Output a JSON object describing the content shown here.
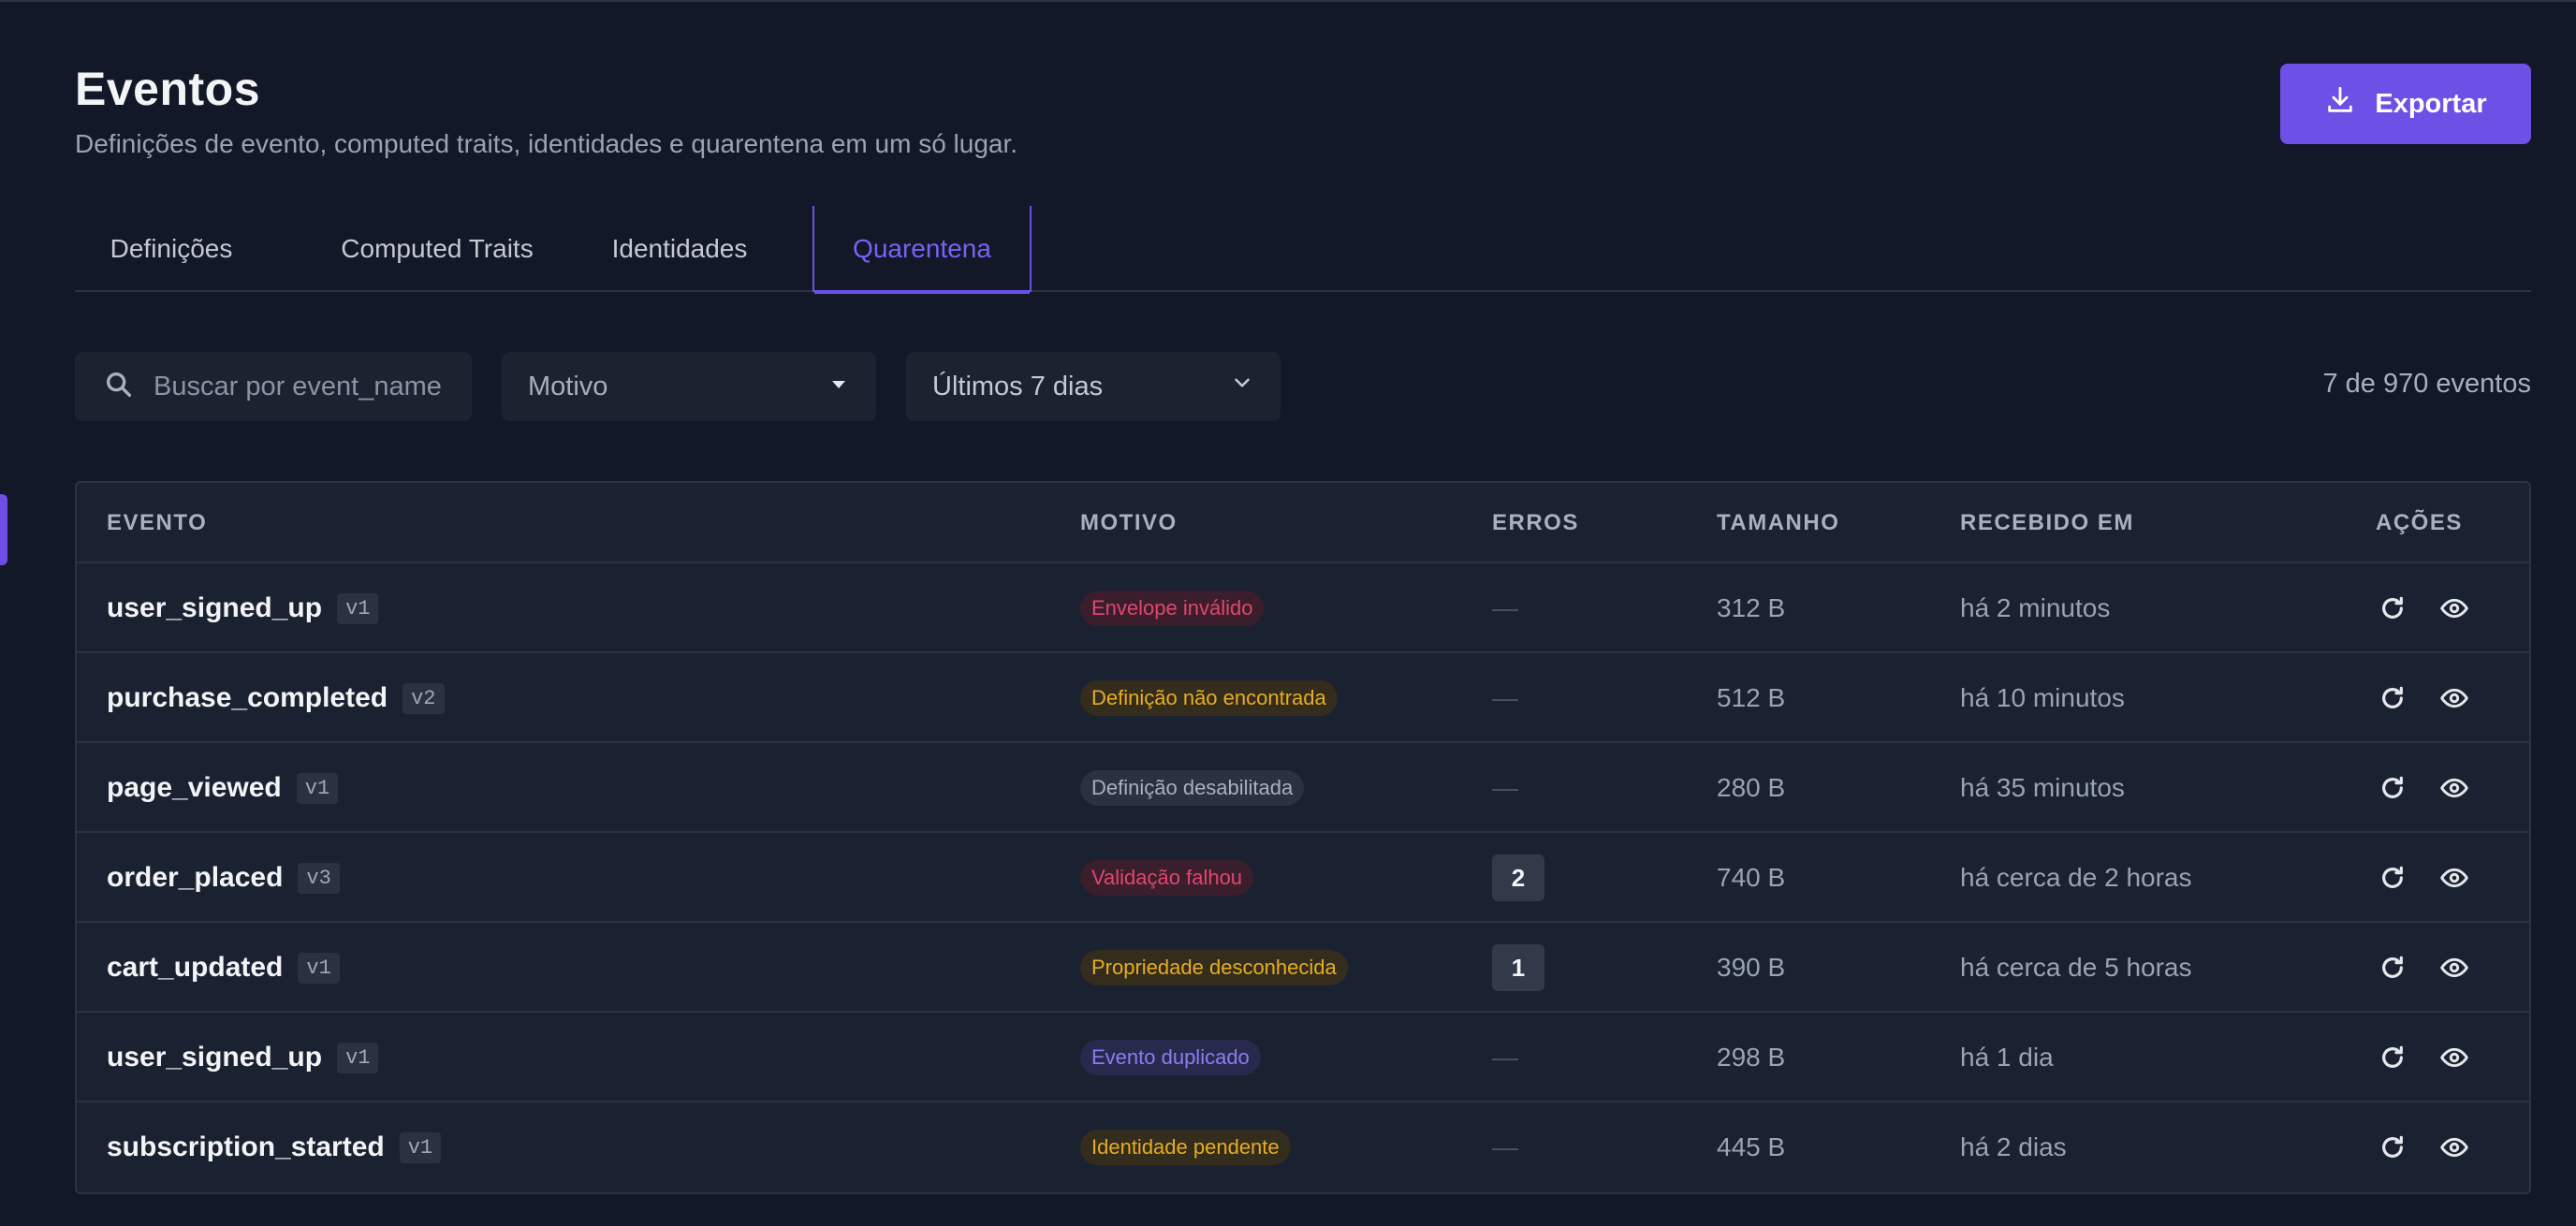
{
  "header": {
    "title": "Eventos",
    "subtitle": "Definições de evento, computed traits, identidades e quarentena em um só lugar.",
    "export_label": "Exportar"
  },
  "tabs": [
    {
      "label": "Definições",
      "active": false
    },
    {
      "label": "Computed Traits",
      "active": false
    },
    {
      "label": "Identidades",
      "active": false
    },
    {
      "label": "Quarentena",
      "active": true
    }
  ],
  "filters": {
    "search_placeholder": "Buscar por event_name",
    "reason_label": "Motivo",
    "period_label": "Últimos 7 dias",
    "count_text": "7 de 970 eventos"
  },
  "table": {
    "columns": [
      "EVENTO",
      "MOTIVO",
      "ERROS",
      "TAMANHO",
      "RECEBIDO EM",
      "AÇÕES"
    ],
    "rows": [
      {
        "event": "user_signed_up",
        "version": "v1",
        "reason": "Envelope inválido",
        "reason_color": "red",
        "errors": "—",
        "size": "312 B",
        "received": "há 2 minutos"
      },
      {
        "event": "purchase_completed",
        "version": "v2",
        "reason": "Definição não encontrada",
        "reason_color": "yellow",
        "errors": "—",
        "size": "512 B",
        "received": "há 10 minutos"
      },
      {
        "event": "page_viewed",
        "version": "v1",
        "reason": "Definição desabilitada",
        "reason_color": "gray",
        "errors": "—",
        "size": "280 B",
        "received": "há 35 minutos"
      },
      {
        "event": "order_placed",
        "version": "v3",
        "reason": "Validação falhou",
        "reason_color": "red",
        "errors": "2",
        "size": "740 B",
        "received": "há cerca de 2 horas"
      },
      {
        "event": "cart_updated",
        "version": "v1",
        "reason": "Propriedade desconhecida",
        "reason_color": "yellow",
        "errors": "1",
        "size": "390 B",
        "received": "há cerca de 5 horas"
      },
      {
        "event": "user_signed_up",
        "version": "v1",
        "reason": "Evento duplicado",
        "reason_color": "purple",
        "errors": "—",
        "size": "298 B",
        "received": "há 1 dia"
      },
      {
        "event": "subscription_started",
        "version": "v1",
        "reason": "Identidade pendente",
        "reason_color": "yellow",
        "errors": "—",
        "size": "445 B",
        "received": "há 2 dias"
      }
    ]
  },
  "icons": {
    "export": "download-icon",
    "search": "search-icon",
    "reason_select": "caret-down-icon",
    "period_select": "chevron-down-icon",
    "retry": "refresh-icon",
    "view": "eye-icon"
  },
  "colors": {
    "accent": "#6d50e6",
    "background": "#121827",
    "danger": "#e2456f",
    "warning": "#e7ad22",
    "info": "#8d7cf2"
  }
}
